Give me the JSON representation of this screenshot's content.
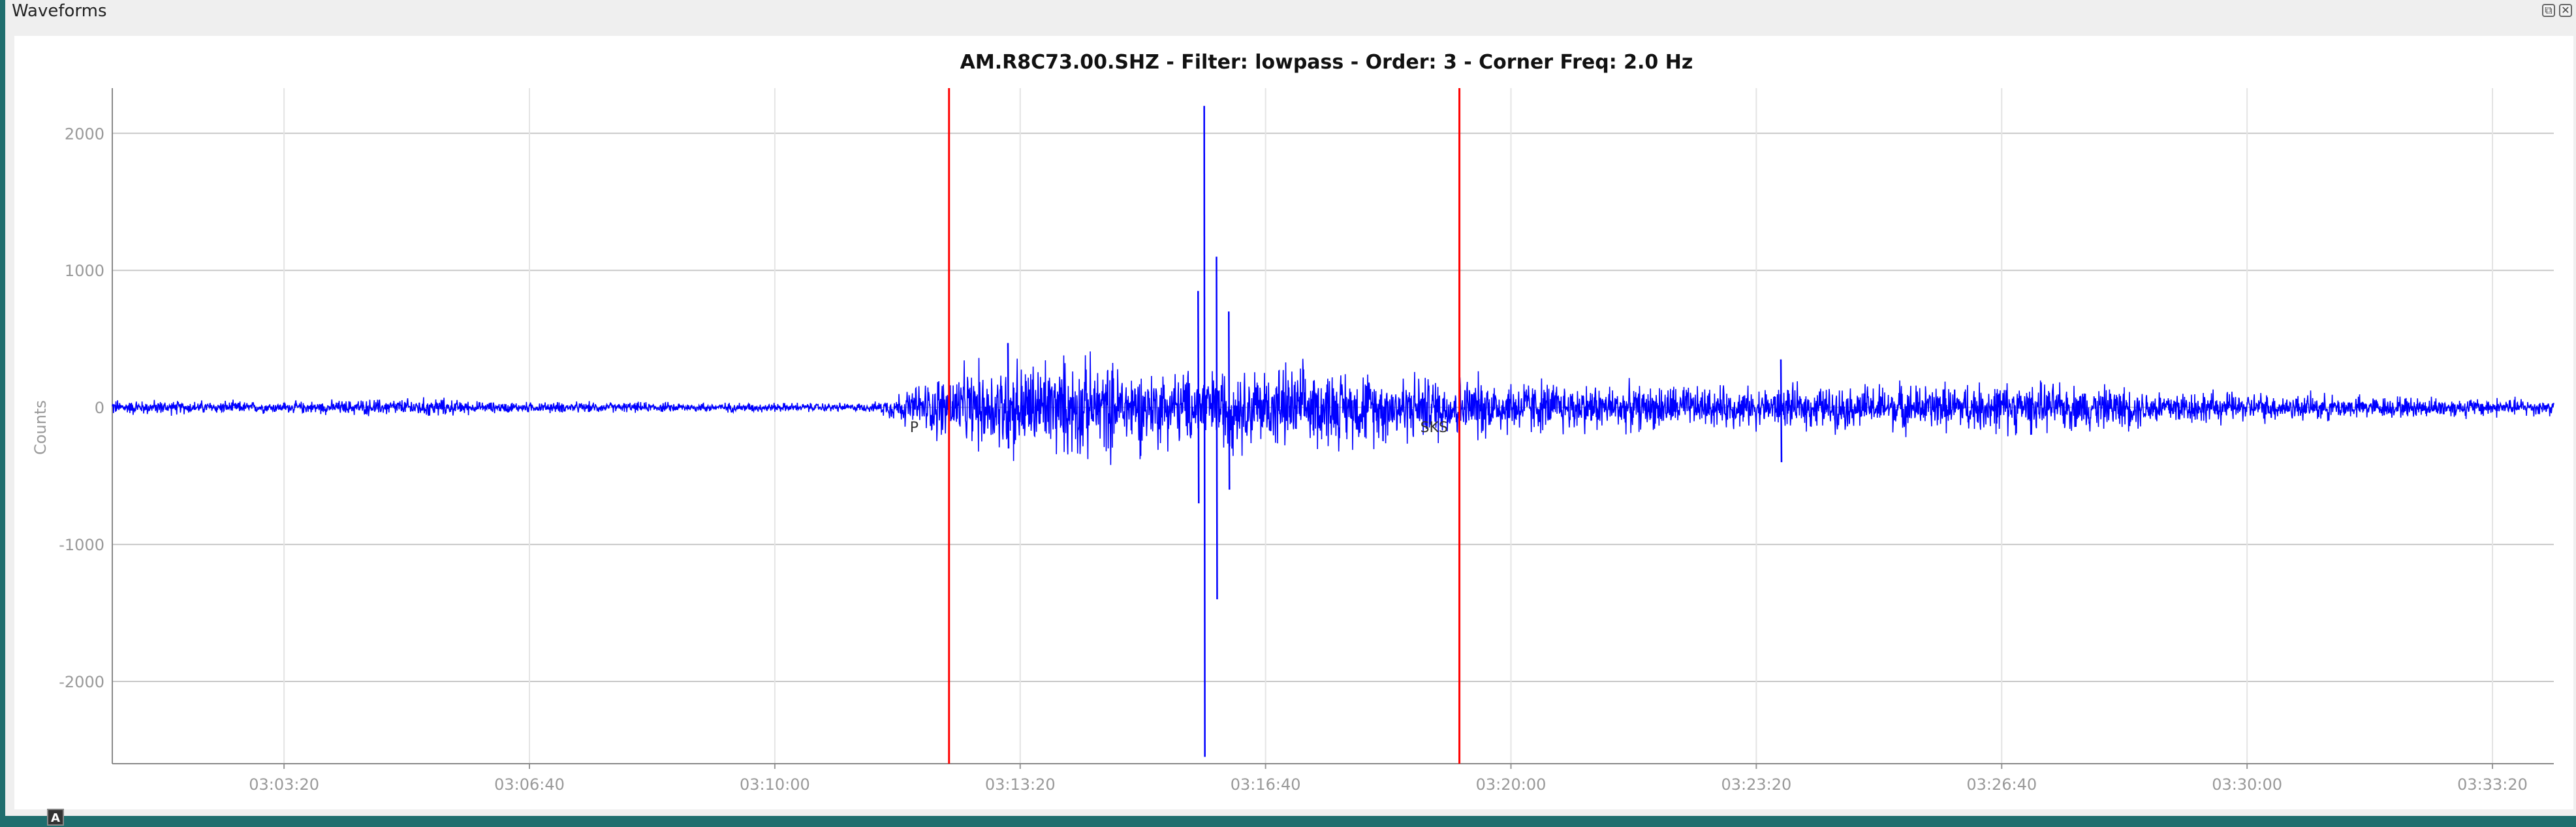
{
  "window": {
    "title": "Waveforms"
  },
  "toolbar": {
    "float_label": "⧉",
    "close_label": "✕",
    "autoscale_label": "A"
  },
  "chart_data": {
    "type": "line",
    "title": "AM.R8C73.00.SHZ - Filter: lowpass - Order: 3 - Corner Freq: 2.0 Hz",
    "ylabel": "Counts",
    "xlabel": "",
    "ylim": [
      -2600,
      2000
    ],
    "y_ticks": [
      2000,
      1000,
      0,
      -1000,
      -2000
    ],
    "y_tick_labels": [
      "2000",
      "1000",
      "0",
      "-1000",
      "-2000"
    ],
    "x_unit": "seconds since 03:02:00",
    "xlim": [
      60,
      2050
    ],
    "x_ticks": [
      200,
      400,
      600,
      800,
      1000,
      1200,
      1400,
      1600,
      1800,
      2000
    ],
    "x_tick_labels": [
      "03:03:20",
      "03:06:40",
      "03:10:00",
      "03:13:20",
      "03:16:40",
      "03:20:00",
      "03:23:20",
      "03:26:40",
      "03:30:00",
      "03:33:20"
    ],
    "grid": true,
    "series": [
      {
        "name": "",
        "color": "#0000ff",
        "envelope": [
          [
            60,
            55
          ],
          [
            200,
            40
          ],
          [
            320,
            70
          ],
          [
            360,
            40
          ],
          [
            500,
            35
          ],
          [
            680,
            30
          ],
          [
            740,
            250
          ],
          [
            800,
            360
          ],
          [
            880,
            330
          ],
          [
            920,
            260
          ],
          [
            1000,
            300
          ],
          [
            1080,
            250
          ],
          [
            1160,
            230
          ],
          [
            1230,
            190
          ],
          [
            1300,
            160
          ],
          [
            1400,
            140
          ],
          [
            1500,
            160
          ],
          [
            1600,
            180
          ],
          [
            1700,
            150
          ],
          [
            1780,
            110
          ],
          [
            1900,
            80
          ],
          [
            2050,
            60
          ]
        ],
        "spikes": [
          {
            "x": 950,
            "max": 2200,
            "min": -2550
          },
          {
            "x": 960,
            "max": 1100,
            "min": -1400
          },
          {
            "x": 945,
            "max": 850,
            "min": -700
          },
          {
            "x": 970,
            "max": 700,
            "min": -600
          },
          {
            "x": 1420,
            "max": 350,
            "min": -400
          },
          {
            "x": 790,
            "max": 470,
            "min": -300
          }
        ]
      }
    ],
    "markers": [
      {
        "x": 742,
        "color": "#ff0000",
        "label": "P"
      },
      {
        "x": 1158,
        "color": "#ff0000",
        "label": "SKS"
      }
    ],
    "marker_labels": [
      "P",
      "SKS"
    ]
  }
}
